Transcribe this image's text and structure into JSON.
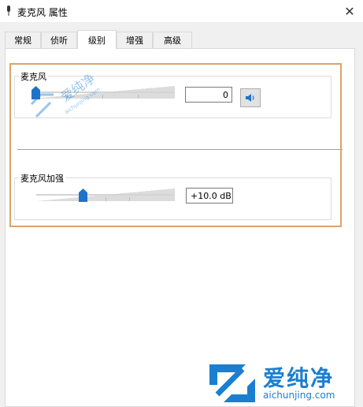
{
  "window": {
    "title": "麦克风 属性",
    "close_glyph": "✕"
  },
  "tabs": [
    {
      "label": "常规",
      "active": false
    },
    {
      "label": "侦听",
      "active": false
    },
    {
      "label": "级别",
      "active": true
    },
    {
      "label": "增强",
      "active": false
    },
    {
      "label": "高级",
      "active": false
    }
  ],
  "levels": {
    "microphone": {
      "label": "麦克风",
      "value": "0",
      "level_fraction": 0.0,
      "mute_icon": "speaker-icon"
    },
    "boost": {
      "label": "麦克风加强",
      "value": "+10.0 dB",
      "level_fraction": 0.33
    }
  },
  "watermark": {
    "brand": "爱纯净",
    "url": "aichunjing.com"
  },
  "colors": {
    "accent": "#1e73c8",
    "highlight_border": "#d9a56b",
    "watermark": "#1a7fd0"
  }
}
